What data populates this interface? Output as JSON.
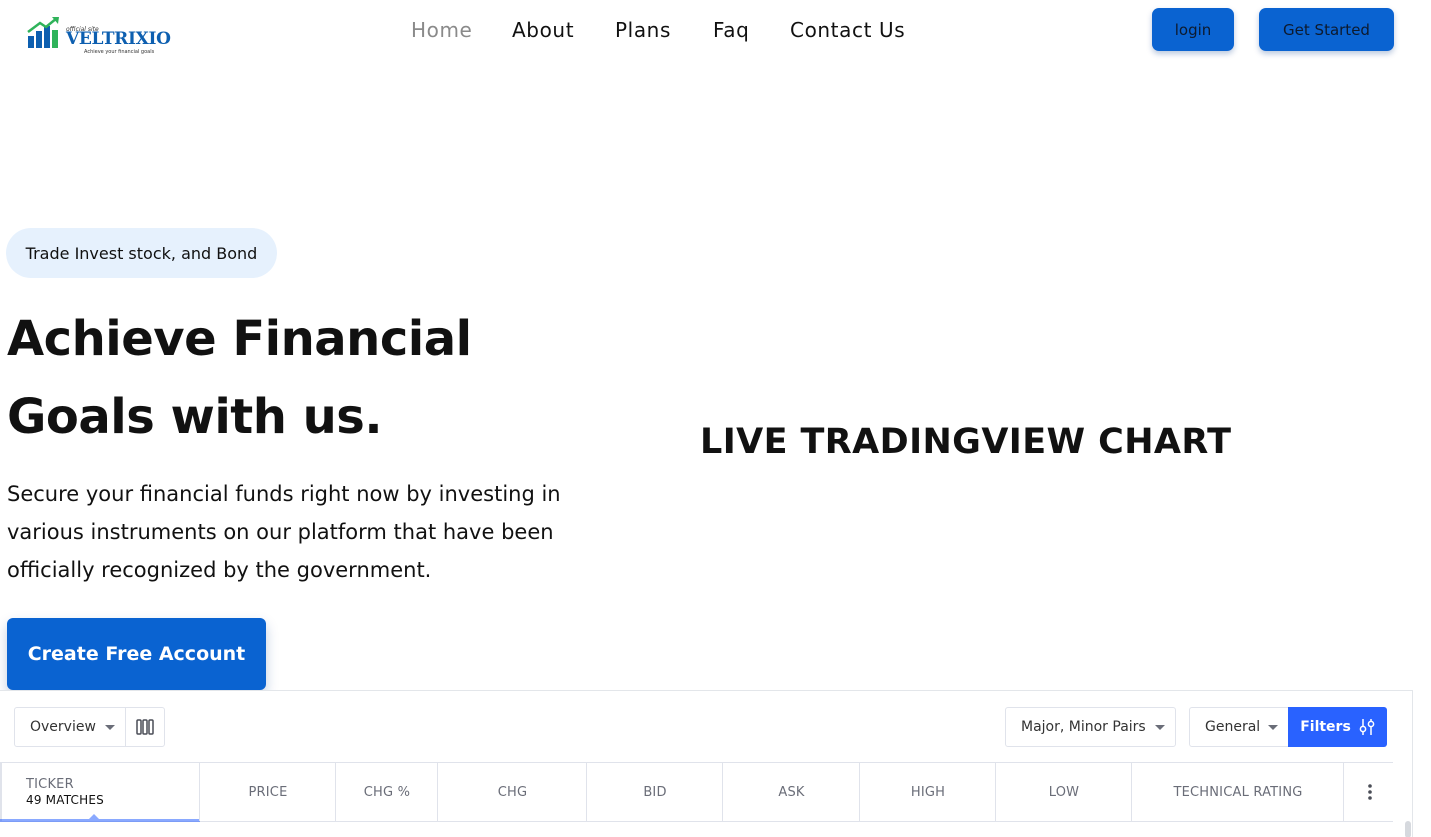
{
  "brand": {
    "official": "official site",
    "name": "VELTRIXIO",
    "tagline": "Achieve your financial goals",
    "colors": {
      "primary": "#0a63d1",
      "logo_green": "#2fb35a",
      "logo_blue": "#0d5fb0"
    }
  },
  "nav": {
    "items": [
      "Home",
      "About",
      "Plans",
      "Faq",
      "Contact Us"
    ],
    "active": "Home"
  },
  "header_buttons": {
    "login": "login",
    "get_started": "Get Started"
  },
  "hero": {
    "pill": "Trade Invest stock, and Bond",
    "title_line1": "Achieve Financial",
    "title_line2": "Goals with us.",
    "desc_line1": "Secure your financial funds right now by investing in",
    "desc_line2": "various instruments on our platform that have been",
    "desc_line3": "officially recognized by the government.",
    "cta": "Create Free Account"
  },
  "live_chart_title": "LIVE TRADINGVIEW CHART",
  "screener": {
    "view_select": "Overview",
    "columns_icon": "columns-icon",
    "market_select": "Major, Minor Pairs",
    "category_select": "General",
    "filters_label": "Filters",
    "filters_icon": "sliders-icon",
    "columns": {
      "ticker": "TICKER",
      "matches": "49 MATCHES",
      "price": "PRICE",
      "chg_pct": "CHG %",
      "chg": "CHG",
      "bid": "BID",
      "ask": "ASK",
      "high": "HIGH",
      "low": "LOW",
      "technical_rating": "TECHNICAL RATING"
    },
    "more_icon": "more-vertical-icon",
    "accent": "#2962ff"
  }
}
